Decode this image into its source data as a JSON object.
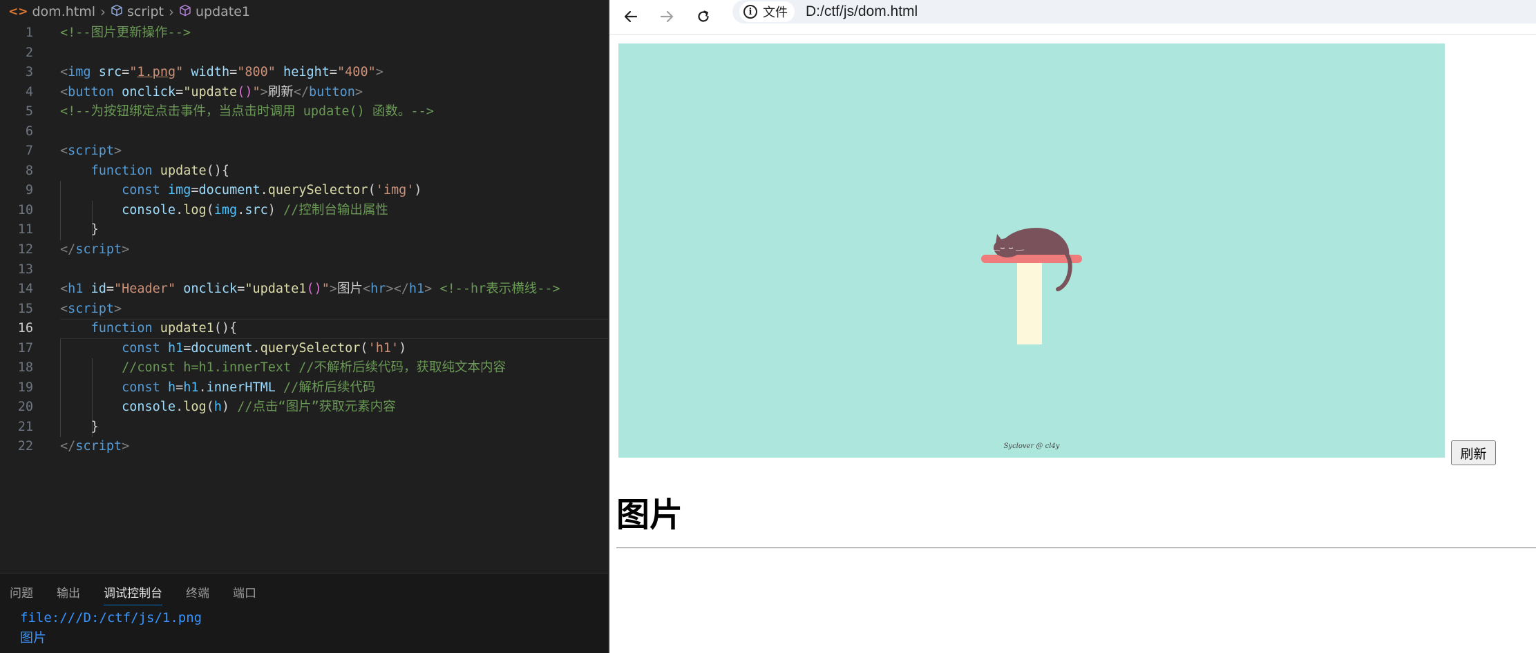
{
  "editor": {
    "breadcrumb": {
      "file": "dom.html",
      "node": "script",
      "symbol": "update1"
    },
    "active_line": 16,
    "lines": [
      {
        "n": "1"
      },
      {
        "n": "2"
      },
      {
        "n": "3"
      },
      {
        "n": "4"
      },
      {
        "n": "5"
      },
      {
        "n": "6"
      },
      {
        "n": "7"
      },
      {
        "n": "8"
      },
      {
        "n": "9"
      },
      {
        "n": "10"
      },
      {
        "n": "11"
      },
      {
        "n": "12"
      },
      {
        "n": "13"
      },
      {
        "n": "14"
      },
      {
        "n": "15"
      },
      {
        "n": "16"
      },
      {
        "n": "17"
      },
      {
        "n": "18"
      },
      {
        "n": "19"
      },
      {
        "n": "20"
      },
      {
        "n": "21"
      },
      {
        "n": "22"
      }
    ],
    "tokens": {
      "l1_comment": "<!--图片更新操作-->",
      "l3_lt": "<",
      "l3_tag": "img",
      "l3_attr1": " src",
      "l3_eq1": "=",
      "l3_q1": "\"",
      "l3_val1": "1.png",
      "l3_q1b": "\"",
      "l3_attr2": " width",
      "l3_eq2": "=",
      "l3_val2": "\"800\"",
      "l3_attr3": " height",
      "l3_eq3": "=",
      "l3_val3": "\"400\"",
      "l3_gt": ">",
      "l4_lt": "<",
      "l4_tag": "button",
      "l4_attr": " onclick",
      "l4_eq": "=",
      "l4_q1": "\"update",
      "l4_paren": "()",
      "l4_q2": "\"",
      "l4_gt": ">",
      "l4_text": "刷新",
      "l4_close_lt": "</",
      "l4_close_tag": "button",
      "l4_close_gt": ">",
      "l5_comment": "<!--为按钮绑定点击事件，当点击时调用 update() 函数。-->",
      "l7_lt": "<",
      "l7_tag": "script",
      "l7_gt": ">",
      "l8_kw": "function",
      "l8_fn": " update",
      "l8_rest": "(){",
      "l9_kw": "const",
      "l9_var": " img",
      "l9_eq": "=",
      "l9_obj": "document",
      "l9_dot": ".",
      "l9_fn": "querySelector",
      "l9_p1": "(",
      "l9_str": "'img'",
      "l9_p2": ")",
      "l10_obj": "console",
      "l10_dot": ".",
      "l10_fn": "log",
      "l10_p1": "(",
      "l10_var": "img",
      "l10_dot2": ".",
      "l10_prop": "src",
      "l10_p2": ")",
      "l10_com": " //控制台输出属性",
      "l11_brace": "}",
      "l12_lt": "</",
      "l12_tag": "script",
      "l12_gt": ">",
      "l14_lt": "<",
      "l14_tag": "h1",
      "l14_attr1": " id",
      "l14_eq1": "=",
      "l14_val1": "\"Header\"",
      "l14_attr2": " onclick",
      "l14_eq2": "=",
      "l14_q1": "\"update1",
      "l14_paren": "()",
      "l14_q2": "\"",
      "l14_gt": ">",
      "l14_text": "图片",
      "l14_hr_lt": "<",
      "l14_hr": "hr",
      "l14_hr_gt": ">",
      "l14_close_lt": "</",
      "l14_close_tag": "h1",
      "l14_close_gt": ">",
      "l14_com": " <!--hr表示横线-->",
      "l15_lt": "<",
      "l15_tag": "script",
      "l15_gt": ">",
      "l16_kw": "function",
      "l16_fn": " update1",
      "l16_rest": "(){",
      "l17_kw": "const",
      "l17_var": " h1",
      "l17_eq": "=",
      "l17_obj": "document",
      "l17_dot": ".",
      "l17_fn": "querySelector",
      "l17_p1": "(",
      "l17_str": "'h1'",
      "l17_p2": ")",
      "l18_com": "//const h=h1.innerText //不解析后续代码，获取纯文本内容",
      "l19_kw": "const",
      "l19_var": " h",
      "l19_eq": "=",
      "l19_obj": "h1",
      "l19_dot": ".",
      "l19_prop": "innerHTML",
      "l19_com": " //解析后续代码",
      "l20_obj": "console",
      "l20_dot": ".",
      "l20_fn": "log",
      "l20_p1": "(",
      "l20_var": "h",
      "l20_p2": ")",
      "l20_com": " //点击“图片”获取元素内容",
      "l21_brace": "}",
      "l22_lt": "</",
      "l22_tag": "script",
      "l22_gt": ">"
    }
  },
  "panel": {
    "tabs": [
      "问题",
      "输出",
      "调试控制台",
      "终端",
      "端口"
    ],
    "active_tab": "调试控制台",
    "console": [
      "file:///D:/ctf/js/1.png",
      "图片"
    ]
  },
  "browser": {
    "site_info_label": "文件",
    "url": "D:/ctf/js/dom.html",
    "image_caption": "Syclover @ cl4y",
    "button_label": "刷新",
    "heading": "图片"
  },
  "colors": {
    "editor_bg": "#1f1f1f",
    "panel_bg": "#181818",
    "image_bg": "#ace6dc",
    "console_text": "#3794ff",
    "accent": "#0078d4"
  },
  "icons": [
    "back-arrow-icon",
    "forward-arrow-icon",
    "reload-icon",
    "info-icon",
    "html-file-icon",
    "cube-icon",
    "symbol-icon"
  ]
}
